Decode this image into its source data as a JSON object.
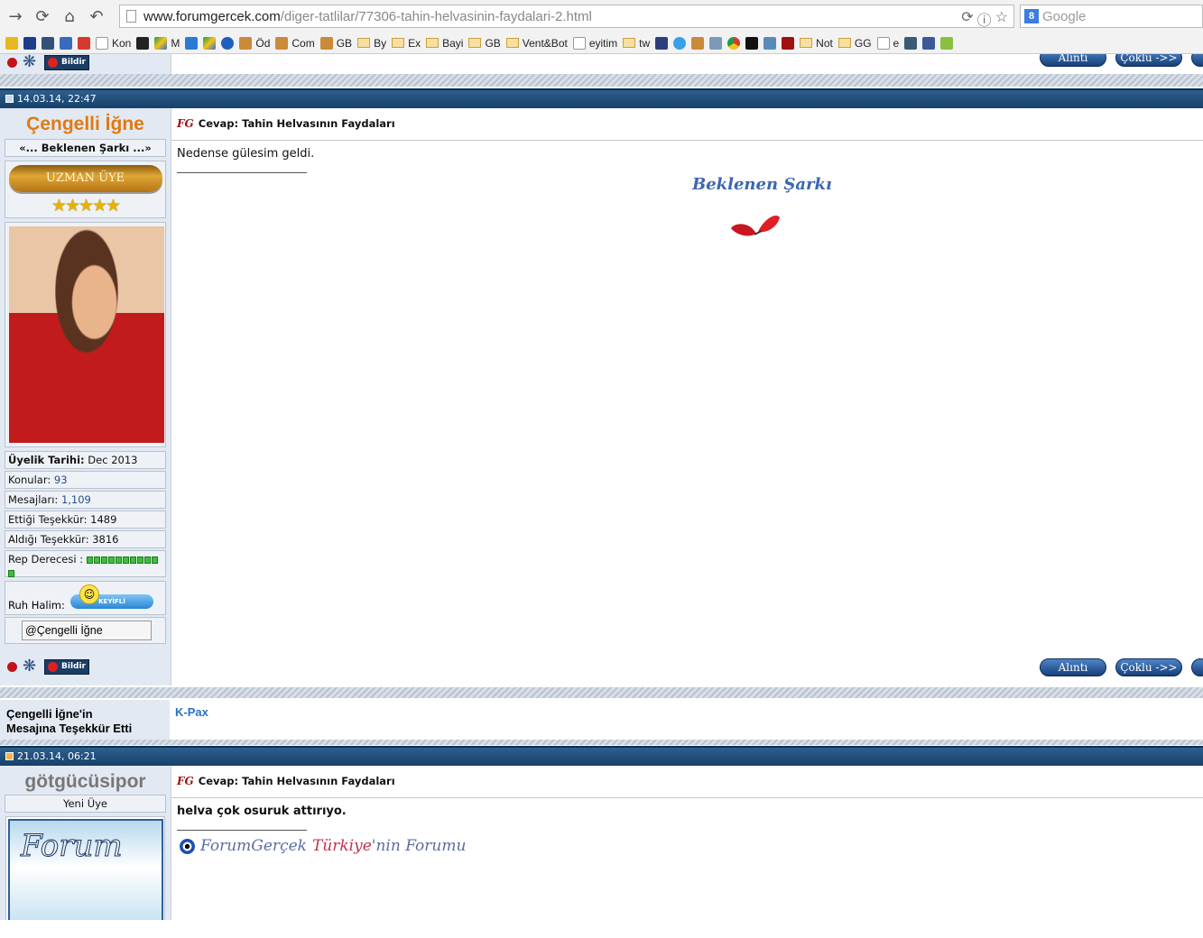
{
  "browser": {
    "url_host": "www.forumgercek.com",
    "url_path": "/diger-tatlilar/77306-tahin-helvasinin-faydalari-2.html",
    "search_placeholder": "Google",
    "bookmarks": [
      "Kon",
      "M",
      "Öd",
      "Com",
      "GB",
      "By",
      "Ex",
      "Bayi",
      "GB",
      "Vent&Bot",
      "eyitim",
      "tw",
      "Not",
      "GG",
      "e"
    ]
  },
  "top_post": {
    "quote_label": "Alıntı",
    "multi_label": "Çoklu ->>"
  },
  "post1": {
    "date": "14.03.14, 22:47",
    "username": "Çengelli İğne",
    "user_title": "«... Beklenen Şarkı ...»",
    "rank": "UZMAN ÜYE",
    "stars": "★★★★★",
    "info": {
      "join_label": "Üyelik Tarihi:",
      "join_value": "Dec 2013",
      "topics_label": "Konular:",
      "topics_value": "93",
      "posts_label": "Mesajları:",
      "posts_value": "1,109",
      "gave_label": "Ettiği Teşekkür:",
      "gave_value": "1489",
      "received_label": "Aldığı Teşekkür:",
      "received_value": "3816",
      "rep_label": "Rep Derecesi :",
      "rep_pips": 11,
      "mood_label": "Ruh Halim:",
      "mood_value": "KEYİFLİ",
      "mention": "@Çengelli İğne"
    },
    "report_label": "Bildir",
    "title": "Cevap: Tahin Helvasının Faydaları",
    "message": "Nedense gülesim geldi.",
    "signature": "Beklenen Şarkı",
    "quote_label": "Alıntı",
    "multi_label": "Çoklu ->>"
  },
  "thanks": {
    "label_line1": "Çengelli İğne'in",
    "label_line2": "Mesajına Teşekkür Etti",
    "users": "K-Pax"
  },
  "post2": {
    "date": "21.03.14, 06:21",
    "username": "götgücüsipor",
    "user_title": "Yeni Üye",
    "avatar_text": "Forum",
    "title": "Cevap: Tahin Helvasının Faydaları",
    "message": "helva çok osuruk attırıyo.",
    "sig_a": "ForumGerçek",
    "sig_b": "Türkiye",
    "sig_c": "'nin Forumu"
  },
  "colors": {
    "header_bar": "#17406a",
    "username1": "#e07a10",
    "username2": "#777777",
    "link_blue": "#2a6fc7"
  }
}
